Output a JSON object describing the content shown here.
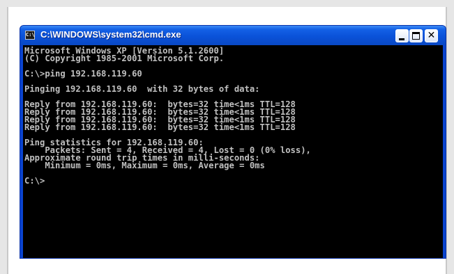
{
  "window": {
    "title": "C:\\WINDOWS\\system32\\cmd.exe",
    "icon_label": "C:\\",
    "icon": "cmd-icon",
    "controls": {
      "minimize_icon": "minimize-icon",
      "maximize_icon": "maximize-icon",
      "close_icon": "close-icon",
      "close_glyph": "✕"
    }
  },
  "console": {
    "lines": [
      "Microsoft Windows XP [Version 5.1.2600]",
      "(C) Copyright 1985-2001 Microsoft Corp.",
      "",
      "C:\\>ping 192.168.119.60",
      "",
      "Pinging 192.168.119.60  with 32 bytes of data:",
      "",
      "Reply from 192.168.119.60:  bytes=32 time<1ms TTL=128",
      "Reply from 192.168.119.60:  bytes=32 time<1ms TTL=128",
      "Reply from 192.168.119.60:  bytes=32 time<1ms TTL=128",
      "Reply from 192.168.119.60:  bytes=32 time<1ms TTL=128",
      "",
      "Ping statistics for 192.168.119.60:",
      "    Packets: Sent = 4, Received = 4, Lost = 0 (0% loss),",
      "Approximate round trip times in milli-seconds:",
      "    Minimum = 0ms, Maximum = 0ms, Average = 0ms",
      "",
      "C:\\>"
    ]
  },
  "colors": {
    "titlebar": "#0a52d9",
    "console_bg": "#000000",
    "console_text": "#c0c0c0"
  }
}
